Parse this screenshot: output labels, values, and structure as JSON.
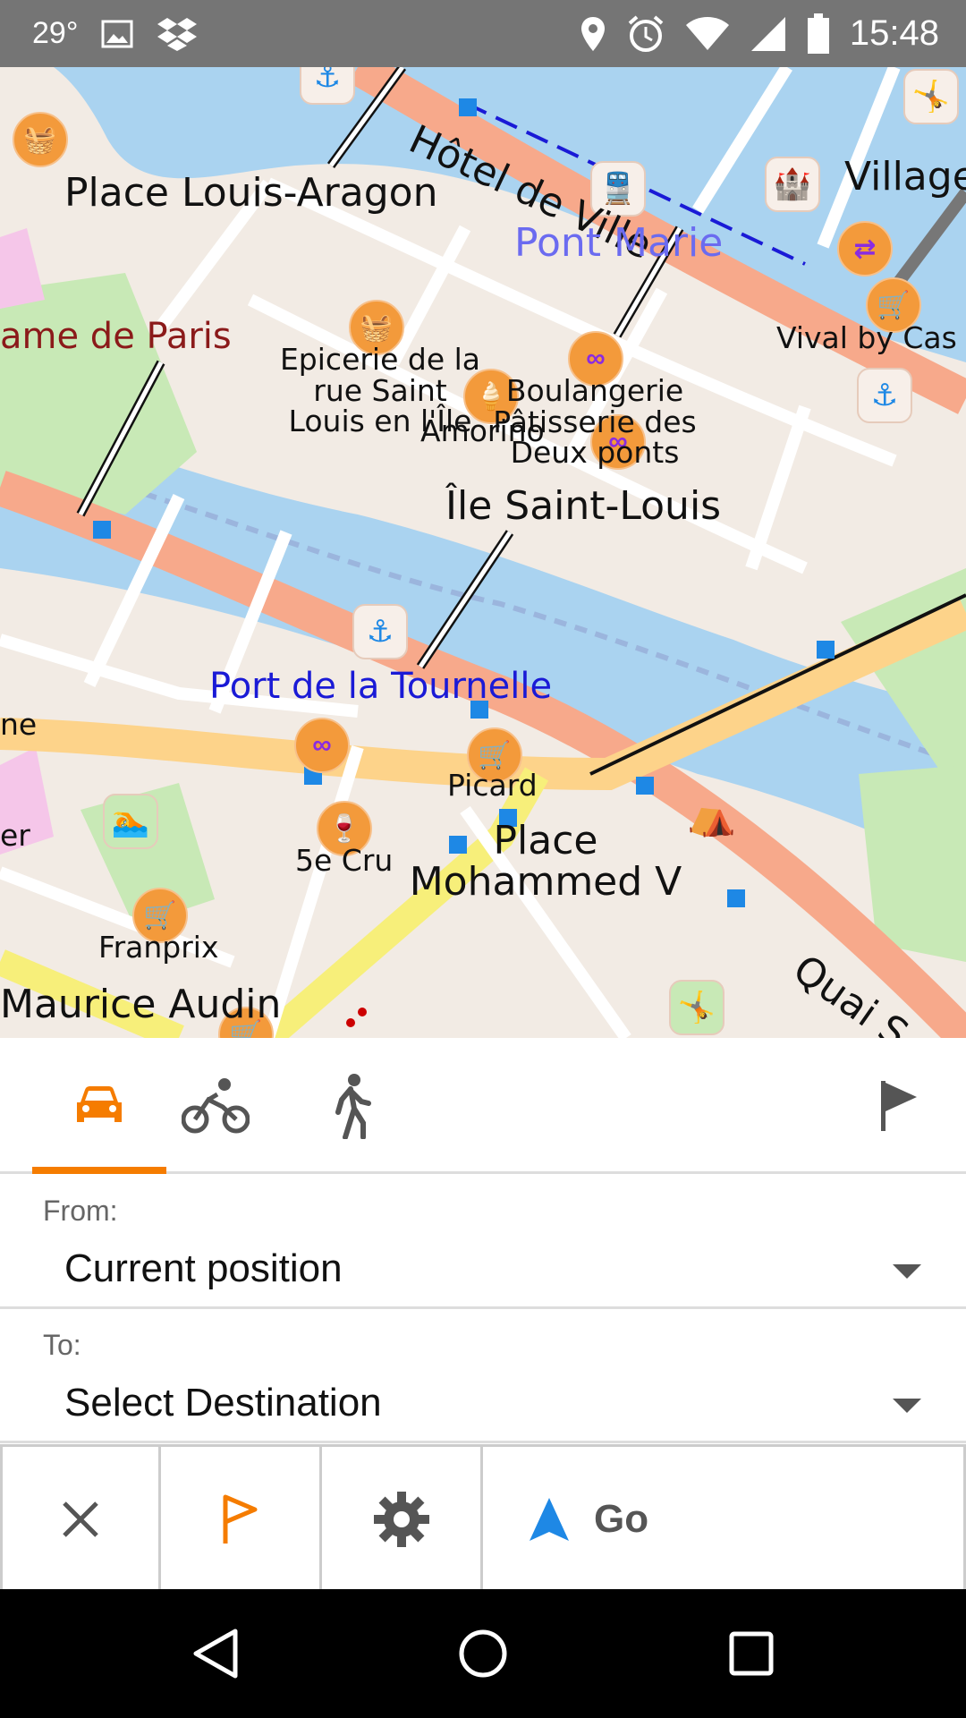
{
  "status_bar": {
    "temperature": "29°",
    "time": "15:48",
    "icons": [
      "image-icon",
      "dropbox-icon",
      "location-pin-icon",
      "alarm-icon",
      "wifi-icon",
      "signal-icon",
      "battery-icon"
    ]
  },
  "map": {
    "labels": {
      "place_louis_aragon": "Place Louis-Aragon",
      "hotel_de_ville": "Hôtel de Ville",
      "village": "Village",
      "pont_marie": "Pont Marie",
      "notre_dame": "ame de Paris",
      "epicerie": "Epicerie de la rue Saint Louis en l'Île",
      "boulangerie": "Boulangerie Pâtisserie des Deux ponts",
      "amorino": "Amorino",
      "vival": "Vival by Cas",
      "ile_saint_louis": "Île Saint-Louis",
      "port_tournelle": "Port de la Tournelle",
      "ne": "ne",
      "er": "er",
      "picard": "Picard",
      "cinq_cru": "5e Cru",
      "place_mohammed": "Place Mohammed V",
      "franprix": "Franprix",
      "maurice_audin": "Maurice Audin",
      "quai": "Quai S"
    },
    "colors": {
      "water": "#aad3f0",
      "primary_road": "#f7a98b",
      "secondary_road": "#fdd38a",
      "park": "#c8e9b6",
      "land": "#f2ebe4"
    }
  },
  "modes": {
    "items": [
      {
        "name": "car",
        "icon": "car-icon",
        "active": true
      },
      {
        "name": "bicycle",
        "icon": "bicycle-icon",
        "active": false
      },
      {
        "name": "pedestrian",
        "icon": "pedestrian-icon",
        "active": false
      }
    ],
    "flag_icon": "flag-icon",
    "accent": "#f57c00"
  },
  "from": {
    "label": "From:",
    "value": "Current position"
  },
  "to": {
    "label": "To:",
    "value": "Select Destination"
  },
  "actions": {
    "go_label": "Go",
    "icons": [
      "close-icon",
      "flag-outline-icon",
      "gear-icon",
      "navigation-arrow-icon"
    ]
  },
  "navbar": {
    "icons": [
      "back-icon",
      "home-icon",
      "recents-icon"
    ]
  }
}
